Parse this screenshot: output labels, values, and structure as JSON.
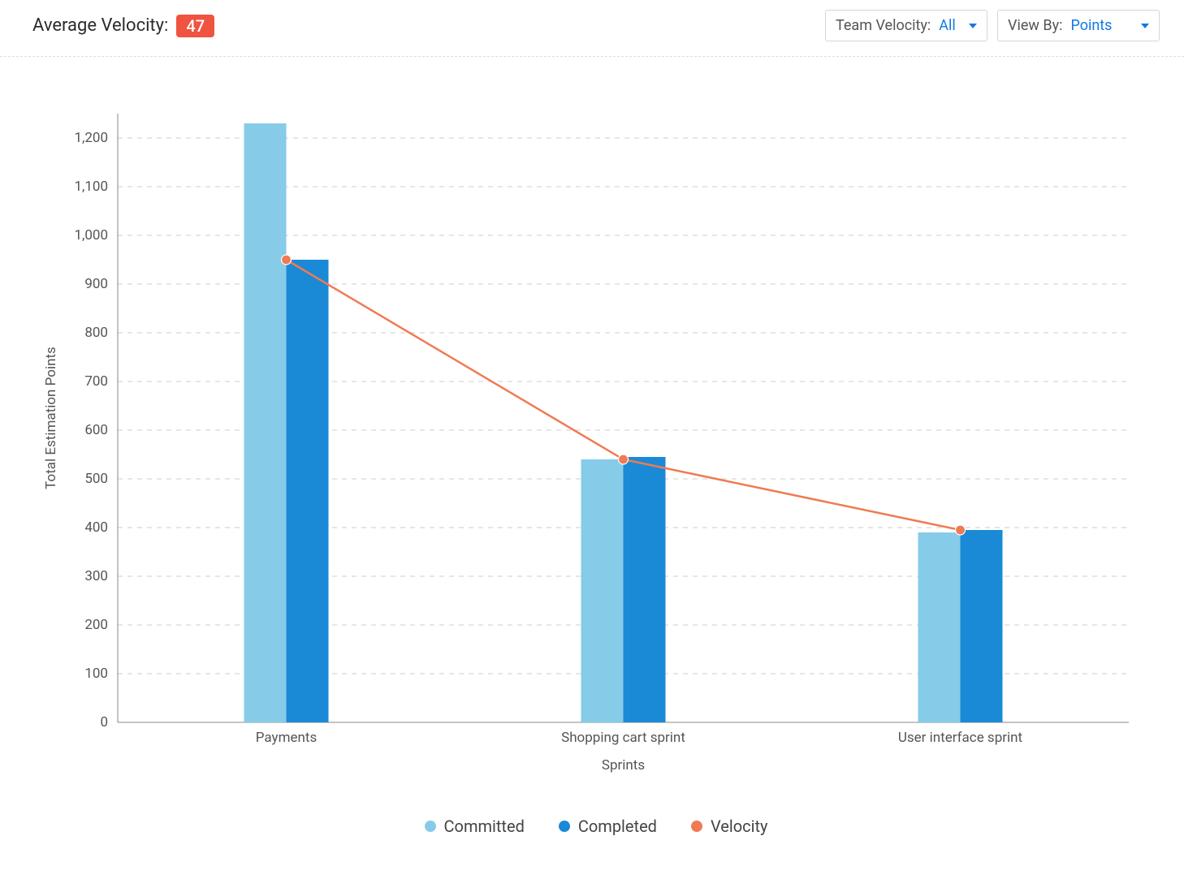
{
  "header": {
    "avg_label": "Average Velocity:",
    "avg_value": "47",
    "team_velocity_label": "Team Velocity:",
    "team_velocity_value": "All",
    "view_by_label": "View By:",
    "view_by_value": "Points"
  },
  "colors": {
    "committed": "#86cbe8",
    "completed": "#1a8ad6",
    "velocity": "#f07a53",
    "badge": "#f05340",
    "accent": "#1279e6"
  },
  "legend": {
    "committed": "Committed",
    "completed": "Completed",
    "velocity": "Velocity"
  },
  "chart_data": {
    "type": "bar",
    "title": "",
    "xlabel": "Sprints",
    "ylabel": "Total Estimation Points",
    "categories": [
      "Payments",
      "Shopping cart sprint",
      "User interface sprint"
    ],
    "series": [
      {
        "name": "Committed",
        "values": [
          1230,
          540,
          390
        ]
      },
      {
        "name": "Completed",
        "values": [
          950,
          545,
          395
        ]
      }
    ],
    "velocity_line": [
      950,
      540,
      395
    ],
    "ylim": [
      0,
      1250
    ],
    "y_ticks": [
      0,
      100,
      200,
      300,
      400,
      500,
      600,
      700,
      800,
      900,
      1000,
      1100,
      1200
    ],
    "y_tick_labels": [
      "0",
      "100",
      "200",
      "300",
      "400",
      "500",
      "600",
      "700",
      "800",
      "900",
      "1,000",
      "1,100",
      "1,200"
    ]
  }
}
